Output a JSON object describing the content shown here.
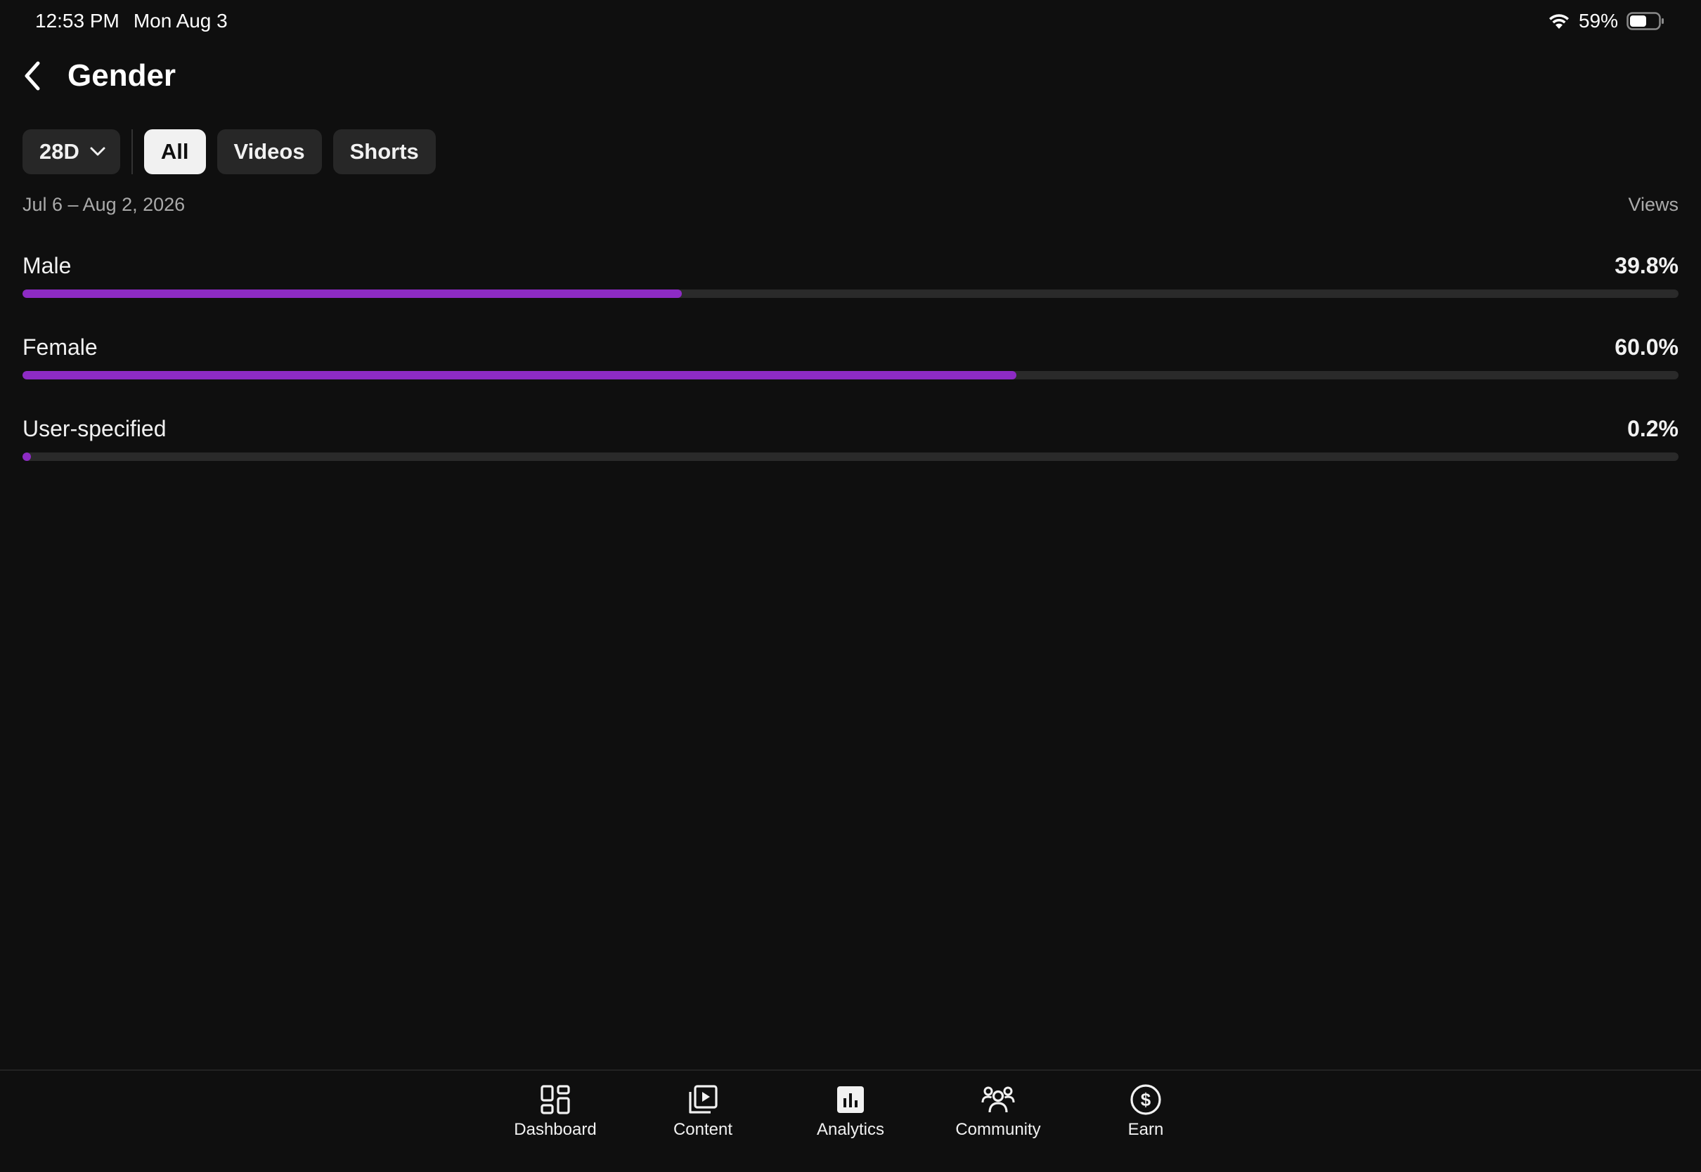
{
  "status_bar": {
    "time": "12:53 PM",
    "date": "Mon Aug 3",
    "battery": "59%",
    "battery_fraction": 0.59
  },
  "header": {
    "title": "Gender",
    "back_icon": "chevron-left-icon"
  },
  "filters": {
    "period": "28D",
    "chips": [
      "All",
      "Videos",
      "Shorts"
    ],
    "selected": "All"
  },
  "range": {
    "dates": "Jul 6 – Aug 2, 2026",
    "metric": "Views"
  },
  "gender_rows": [
    {
      "label": "Male",
      "value": "39.8%",
      "fraction": 0.398
    },
    {
      "label": "Female",
      "value": "60.0%",
      "fraction": 0.6
    },
    {
      "label": "User-specified",
      "value": "0.2%",
      "fraction": 0.002
    }
  ],
  "colors": {
    "bar_fill": "#8d2bc4",
    "track": "#2a2a2a",
    "background": "#0f0f0f"
  },
  "bottom_nav": {
    "items": [
      {
        "label": "Dashboard",
        "icon": "dashboard-icon"
      },
      {
        "label": "Content",
        "icon": "content-icon"
      },
      {
        "label": "Analytics",
        "icon": "analytics-icon"
      },
      {
        "label": "Community",
        "icon": "community-icon"
      },
      {
        "label": "Earn",
        "icon": "earn-icon"
      }
    ],
    "selected": "Analytics"
  }
}
